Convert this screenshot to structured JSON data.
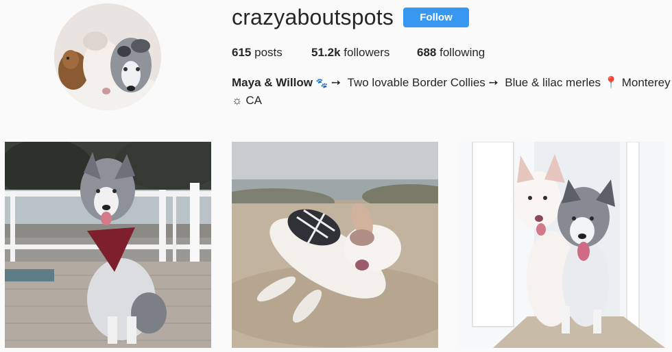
{
  "profile": {
    "username": "crazyaboutspots",
    "follow_label": "Follow",
    "stats": {
      "posts_count": "615",
      "posts_label": "posts",
      "followers_count": "51.2k",
      "followers_label": "followers",
      "following_count": "688",
      "following_label": "following"
    },
    "bio": {
      "name": "Maya & Willow",
      "paw_glyph": "🐾",
      "arrow1": "➙",
      "part1": "Two lovable Border Collies",
      "arrow2": "➙",
      "part2": "Blue & lilac merles",
      "pin_glyph": "📍",
      "part3": "Monterey",
      "sun_glyph": "☼",
      "part4": "CA"
    }
  },
  "colors": {
    "accent": "#3897f0",
    "background": "#fafafa",
    "text": "#262626"
  },
  "posts": [
    {
      "icon": "photo-dog-bandana-deck"
    },
    {
      "icon": "photo-dog-sleeping-sand"
    },
    {
      "icon": "photo-two-dogs-doorway"
    }
  ]
}
